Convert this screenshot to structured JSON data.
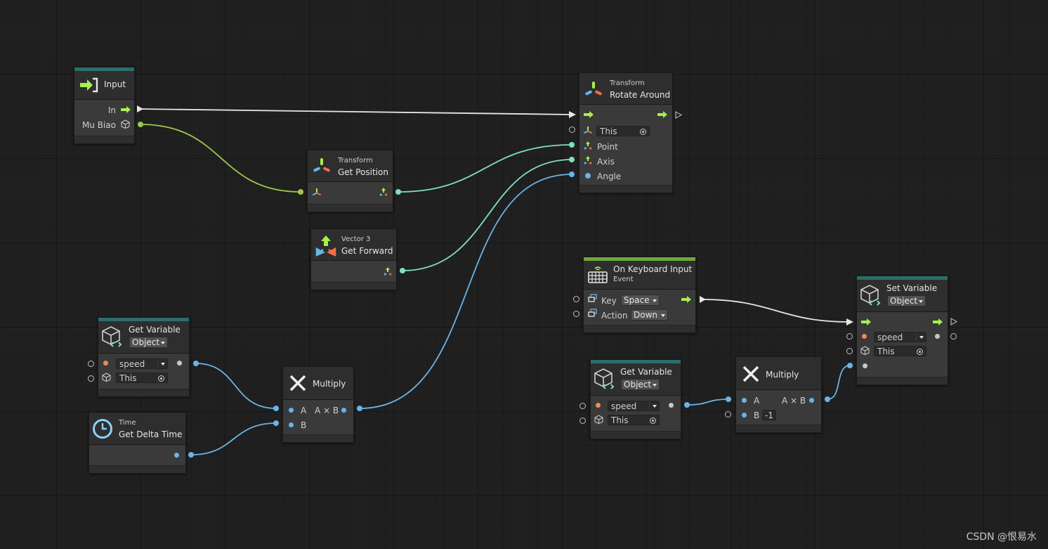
{
  "nodes": {
    "input": {
      "title": "Input",
      "ports": [
        "In",
        "Mu Biao"
      ]
    },
    "get_position": {
      "category": "Transform",
      "title": "Get Position"
    },
    "rotate_around": {
      "category": "Transform",
      "title": "Rotate Around",
      "this_value": "This",
      "ports": [
        "Point",
        "Axis",
        "Angle"
      ]
    },
    "get_forward": {
      "category": "Vector 3",
      "title": "Get Forward"
    },
    "get_variable_1": {
      "title": "Get Variable",
      "kind": "Object",
      "name_value": "speed",
      "target_value": "This"
    },
    "get_delta_time": {
      "category": "Time",
      "title": "Get Delta Time"
    },
    "multiply_1": {
      "title": "Multiply",
      "port_a": "A",
      "port_b": "B",
      "output": "A × B"
    },
    "on_keyboard": {
      "title": "On Keyboard Input",
      "category": "Event",
      "key_label": "Key",
      "key_value": "Space",
      "action_label": "Action",
      "action_value": "Down"
    },
    "get_variable_2": {
      "title": "Get Variable",
      "kind": "Object",
      "name_value": "speed",
      "target_value": "This"
    },
    "multiply_2": {
      "title": "Multiply",
      "port_a": "A",
      "port_b": "B",
      "output": "A × B",
      "b_value": "-1"
    },
    "set_variable": {
      "title": "Set Variable",
      "kind": "Object",
      "name_value": "speed",
      "target_value": "This"
    }
  },
  "colors": {
    "background": "#202020",
    "node_header": "#2e2e2e",
    "node_body": "#3a3a3a",
    "teal_bar": "#2c6e6a",
    "green_bar": "#6aab3a",
    "wire_float": "#6ab4e8",
    "wire_vector": "#7ee0c0",
    "wire_object": "#9ec94a",
    "wire_flow": "#e6e6e6",
    "flow_arrow": "#a6f04a"
  },
  "icons": [
    "input-icon",
    "transform-icon",
    "vector3-icon",
    "variable-cube-icon",
    "clock-icon",
    "multiply-icon",
    "keyboard-icon",
    "flow-arrow-icon",
    "object-cube-icon",
    "target-icon"
  ],
  "watermark": "CSDN @恨易水"
}
